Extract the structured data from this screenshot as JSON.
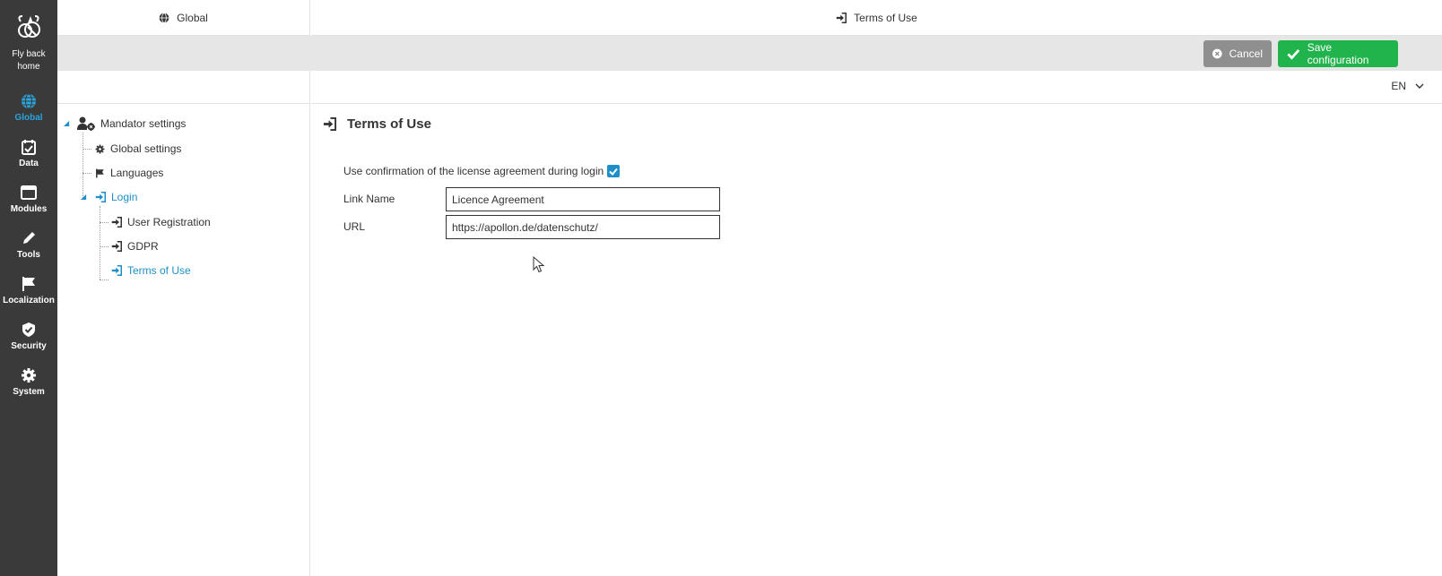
{
  "rail": {
    "home": {
      "label_line1": "Fly back",
      "label_line2": "home",
      "icon": "bee-icon"
    },
    "items": [
      {
        "label": "Global",
        "icon": "globe-icon",
        "active": true
      },
      {
        "label": "Data",
        "icon": "calendar-icon",
        "active": false
      },
      {
        "label": "Modules",
        "icon": "window-icon",
        "active": false
      },
      {
        "label": "Tools",
        "icon": "pencil-icon",
        "active": false
      },
      {
        "label": "Localization",
        "icon": "flag-icon",
        "active": false
      },
      {
        "label": "Security",
        "icon": "shield-icon",
        "active": false
      },
      {
        "label": "System",
        "icon": "gear-icon",
        "active": false
      }
    ]
  },
  "header": {
    "left_title": "Global",
    "right_title": "Terms of Use"
  },
  "toolbar": {
    "cancel_label": "Cancel",
    "save_label": "Save configuration"
  },
  "language": {
    "selected": "EN"
  },
  "tree": {
    "root": "Mandator settings",
    "global_settings": "Global settings",
    "languages": "Languages",
    "login": "Login",
    "user_registration": "User Registration",
    "gdpr": "GDPR",
    "terms_of_use": "Terms of Use"
  },
  "content": {
    "title": "Terms of Use",
    "checkbox_label": "Use confirmation of the license agreement during login",
    "checkbox_checked": true,
    "link_name_label": "Link Name",
    "link_name_value": "Licence Agreement",
    "url_label": "URL",
    "url_value": "https://apollon.de/datenschutz/"
  },
  "colors": {
    "rail_bg": "#3a3a3a",
    "accent": "#1e8fc9",
    "save": "#21b34c",
    "cancel": "#8f8f8f"
  }
}
